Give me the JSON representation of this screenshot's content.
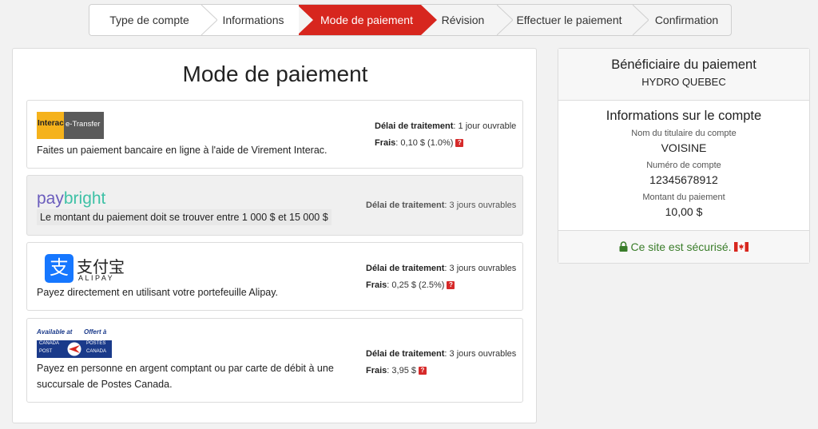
{
  "stepper": {
    "steps": [
      {
        "label": "Type de compte",
        "active": false
      },
      {
        "label": "Informations",
        "active": false
      },
      {
        "label": "Mode de paiement",
        "active": true
      },
      {
        "label": "Révision",
        "active": false
      },
      {
        "label": "Effectuer le paiement",
        "active": false
      },
      {
        "label": "Confirmation",
        "active": false
      }
    ],
    "active_color": "#d7261e"
  },
  "main": {
    "title": "Mode de paiement",
    "methods": [
      {
        "logo": "interac-etransfer-logo",
        "logo_text_1": "Interac",
        "logo_text_2": "e-Transfer",
        "description": "Faites un paiement bancaire en ligne à l'aide de Virement Interac.",
        "delay_label": "Délai de traitement",
        "delay_value": ": 1 jour ouvrable",
        "fee_label": "Frais",
        "fee_value": ": 0,10 $ (1.0%)",
        "help": "?"
      },
      {
        "logo": "paybright-logo",
        "logo_text_1": "pay",
        "logo_text_2": "bright",
        "description": "Le montant du paiement doit se trouver entre 1 000 $ et 15 000 $",
        "delay_label": "Délai de traitement",
        "delay_value": ": 3 jours ouvrables"
      },
      {
        "logo": "alipay-logo",
        "logo_text_1": "支付宝",
        "logo_text_2": "ALIPAY",
        "description": "Payez directement en utilisant votre portefeuille Alipay.",
        "delay_label": "Délai de traitement",
        "delay_value": ": 3 jours ouvrables",
        "fee_label": "Frais",
        "fee_value": ": 0,25 $ (2.5%)",
        "help": "?"
      },
      {
        "logo": "canada-post-logo",
        "logo_text_1": "Available at",
        "logo_text_2": "Offert à",
        "logo_text_3": "CANADA",
        "logo_text_4": "POST",
        "logo_text_5": "POSTES",
        "logo_text_6": "CANADA",
        "description_1": "Payez en personne en argent comptant ou par carte de débit à une",
        "description_2": "succursale de Postes Canada.",
        "delay_label": "Délai de traitement",
        "delay_value": ": 3 jours ouvrables",
        "fee_label": "Frais",
        "fee_value": ": 3,95 $",
        "help": "?"
      }
    ]
  },
  "sidebar": {
    "payee_title": "Bénéficiaire du paiement",
    "payee_name": "HYDRO QUEBEC",
    "account_title": "Informations sur le compte",
    "holder_label": "Nom du titulaire du compte",
    "holder_value": "VOISINE",
    "account_no_label": "Numéro de compte",
    "account_no_value": "12345678912",
    "amount_label": "Montant du paiement",
    "amount_value": "10,00 $",
    "secure_text": "Ce site est sécurisé.",
    "secure_color": "#3a7d2a"
  }
}
